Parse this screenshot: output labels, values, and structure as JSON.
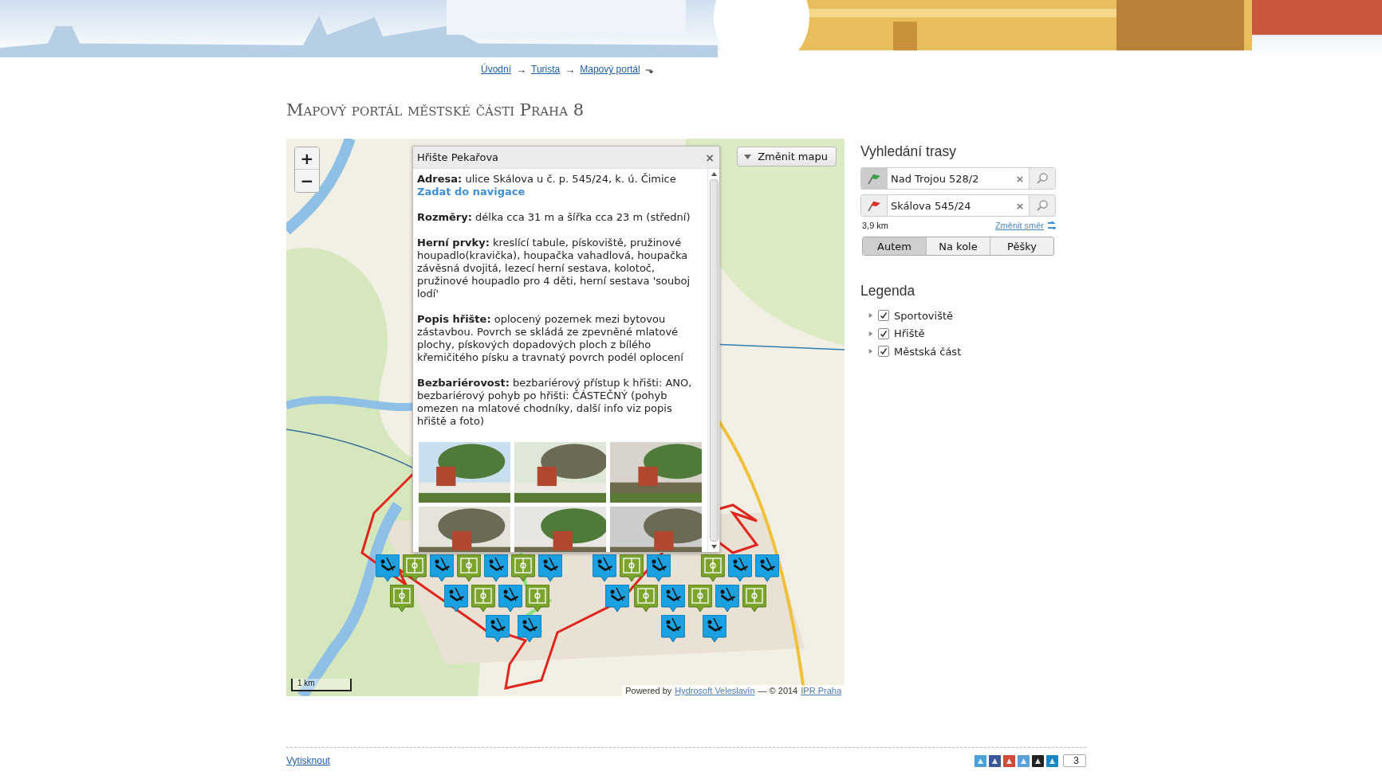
{
  "breadcrumb": [
    {
      "label": "Úvodní",
      "arrow": "→"
    },
    {
      "label": "Turista",
      "arrow": "→"
    },
    {
      "label": "Mapový portál",
      "arrow": "⬎"
    }
  ],
  "page_title": "Mapový portál městské části Praha 8",
  "map": {
    "zoom_in": "+",
    "zoom_out": "−",
    "change_map": "Změnit mapu",
    "scale": "1 km",
    "attribution": {
      "prefix": "Powered by",
      "author": "Hydrosoft Veleslavín",
      "year": "— © 2014",
      "owner": "IPR Praha"
    },
    "popup": {
      "title": "Hřište Pekařova",
      "close": "×",
      "sections": [
        {
          "text": "**Adresa:** ulice Skálova u č. p. 545/24, k. ú. Čimice",
          "link": "Zadat do navigace"
        },
        {
          "text": "**Rozměry:** délka cca 31 m a šířka cca 23 m (střední)"
        },
        {
          "text": "**Herní prvky:** kreslící tabule, pískoviště, pružinové houpadlo(kravička), houpačka vahadlová, houpačka závěsná dvojitá, lezecí herní sestava, kolotoč, pružinové houpadlo pro 4 děti, herní sestava 'souboj lodí'"
        },
        {
          "text": "**Popis hřište:** oplocený pozemek mezi bytovou zástavbou. Povrch se skládá ze zpevněné mlatové plochy, pískových dopadových ploch z bílého křemičitého písku a travnatý povrch podél oplocení"
        },
        {
          "text": "**Bezbariérovost:** bezbariérový přístup k hřišti: ANO, bezbariérový pohyb po hřišti: ČÁSTEČNÝ (pohyb omezen na mlatové chodníky, další info viz popis hřiště a foto)"
        }
      ]
    }
  },
  "route": {
    "title": "Vyhledání trasy",
    "fields": [
      {
        "kind": "start",
        "value": "Nad Trojou 528/2",
        "clear": "×"
      },
      {
        "kind": "end",
        "value": "Skálova 545/24",
        "clear": "×"
      }
    ],
    "distance": "3,9 km",
    "reverse": "Změnit směr",
    "modes": [
      {
        "label": "Autem",
        "selected": true
      },
      {
        "label": "Na kole",
        "selected": false
      },
      {
        "label": "Pěšky",
        "selected": false
      }
    ]
  },
  "legend": {
    "title": "Legenda",
    "items": [
      {
        "label": "Sportoviště",
        "checked": true,
        "expanded": false
      },
      {
        "label": "Hřiště",
        "checked": true,
        "expanded": false
      },
      {
        "label": "Městská část",
        "checked": true,
        "expanded": false
      }
    ]
  },
  "footer": {
    "print": "Vytisknout",
    "share_count": "3"
  }
}
